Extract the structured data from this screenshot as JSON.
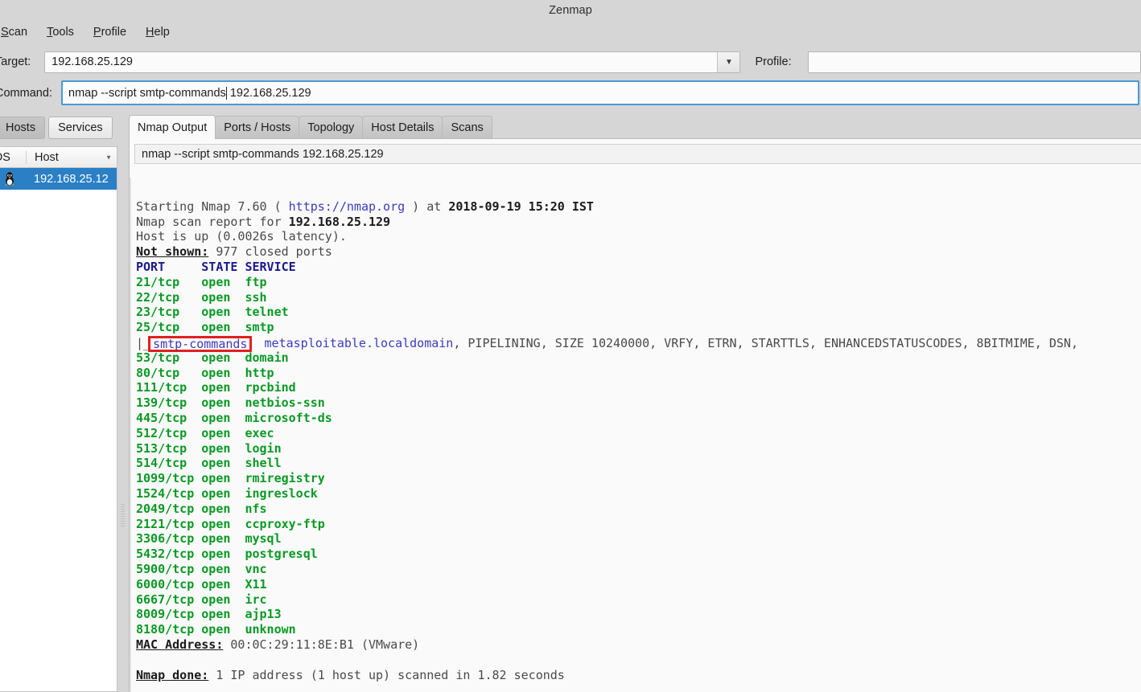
{
  "window": {
    "title": "Zenmap"
  },
  "menu": {
    "items": [
      {
        "label": "Scan",
        "mnemonic": "S"
      },
      {
        "label": "Tools",
        "mnemonic": "T"
      },
      {
        "label": "Profile",
        "mnemonic": "P"
      },
      {
        "label": "Help",
        "mnemonic": "H"
      }
    ]
  },
  "toolbar": {
    "target_label": "Target:",
    "target_value": "192.168.25.129",
    "target_placeholder": "",
    "dropdown_icon": "chevron-down-icon",
    "profile_label": "Profile:",
    "profile_value": "",
    "profile_placeholder": "",
    "command_label": "Command:",
    "command_value_before_caret": "nmap --script smtp-commands",
    "command_value_after_caret": " 192.168.25.129",
    "command_value": "nmap --script smtp-commands 192.168.25.129"
  },
  "sidebar": {
    "toggles": [
      {
        "label": "Hosts",
        "active": true
      },
      {
        "label": "Services",
        "active": false
      }
    ],
    "columns": [
      "OS",
      "Host"
    ],
    "sort_icon": "sort-descending-icon",
    "rows": [
      {
        "os_icon": "linux-penguin-icon",
        "host": "192.168.25.12"
      }
    ]
  },
  "tabs": [
    {
      "label": "Nmap Output",
      "active": true
    },
    {
      "label": "Ports / Hosts",
      "active": false
    },
    {
      "label": "Topology",
      "active": false
    },
    {
      "label": "Host Details",
      "active": false
    },
    {
      "label": "Scans",
      "active": false
    }
  ],
  "output": {
    "command_bar": "nmap --script smtp-commands 192.168.25.129",
    "lines": [
      {
        "id": "blank1",
        "text": ""
      },
      {
        "id": "starting",
        "segs": [
          {
            "t": "Starting Nmap 7.60 ( ",
            "c": "c-plain"
          },
          {
            "t": "https://nmap.org",
            "c": "c-link"
          },
          {
            "t": " ) at ",
            "c": "c-plain"
          },
          {
            "t": "2018-09-19 15:20 IST",
            "c": "c-bold"
          }
        ]
      },
      {
        "id": "scanreport",
        "segs": [
          {
            "t": "Nmap scan report for ",
            "c": "c-plain"
          },
          {
            "t": "192.168.25.129",
            "c": "c-bold"
          }
        ]
      },
      {
        "id": "hostup",
        "segs": [
          {
            "t": "Host is up (0.0026s latency).",
            "c": "c-plain"
          }
        ]
      },
      {
        "id": "notshown",
        "segs": [
          {
            "t": "Not shown:",
            "c": "c-uhdr"
          },
          {
            "t": " 977 closed ports",
            "c": "c-plain"
          }
        ]
      },
      {
        "id": "portheader",
        "segs": [
          {
            "t": "PORT     STATE SERVICE",
            "c": "c-hdr"
          }
        ]
      },
      {
        "id": "p21",
        "segs": [
          {
            "t": "21/tcp   open  ftp",
            "c": "c-port"
          }
        ]
      },
      {
        "id": "p22",
        "segs": [
          {
            "t": "22/tcp   open  ssh",
            "c": "c-port"
          }
        ]
      },
      {
        "id": "p23",
        "segs": [
          {
            "t": "23/tcp   open  telnet",
            "c": "c-port"
          }
        ]
      },
      {
        "id": "p25",
        "segs": [
          {
            "t": "25/tcp   open  smtp",
            "c": "c-port"
          }
        ]
      },
      {
        "id": "smtpscript",
        "highlight": "smtp-commands",
        "segs": [
          {
            "t": "|_",
            "c": "c-plain"
          },
          {
            "t": "smtp-commands",
            "c": "c-script",
            "box": true
          },
          {
            "t": "  metasploitable.localdomain",
            "c": "c-script"
          },
          {
            "t": ", PIPELINING, SIZE 10240000, VRFY, ETRN, STARTTLS, ENHANCEDSTATUSCODES, 8BITMIME, DSN, ",
            "c": "c-plain"
          }
        ]
      },
      {
        "id": "p53",
        "segs": [
          {
            "t": "53/tcp   open  domain",
            "c": "c-port"
          }
        ]
      },
      {
        "id": "p80",
        "segs": [
          {
            "t": "80/tcp   open  http",
            "c": "c-port"
          }
        ]
      },
      {
        "id": "p111",
        "segs": [
          {
            "t": "111/tcp  open  rpcbind",
            "c": "c-port"
          }
        ]
      },
      {
        "id": "p139",
        "segs": [
          {
            "t": "139/tcp  open  netbios-ssn",
            "c": "c-port"
          }
        ]
      },
      {
        "id": "p445",
        "segs": [
          {
            "t": "445/tcp  open  microsoft-ds",
            "c": "c-port"
          }
        ]
      },
      {
        "id": "p512",
        "segs": [
          {
            "t": "512/tcp  open  exec",
            "c": "c-port"
          }
        ]
      },
      {
        "id": "p513",
        "segs": [
          {
            "t": "513/tcp  open  login",
            "c": "c-port"
          }
        ]
      },
      {
        "id": "p514",
        "segs": [
          {
            "t": "514/tcp  open  shell",
            "c": "c-port"
          }
        ]
      },
      {
        "id": "p1099",
        "segs": [
          {
            "t": "1099/tcp open  rmiregistry",
            "c": "c-port"
          }
        ]
      },
      {
        "id": "p1524",
        "segs": [
          {
            "t": "1524/tcp open  ingreslock",
            "c": "c-port"
          }
        ]
      },
      {
        "id": "p2049",
        "segs": [
          {
            "t": "2049/tcp open  nfs",
            "c": "c-port"
          }
        ]
      },
      {
        "id": "p2121",
        "segs": [
          {
            "t": "2121/tcp open  ccproxy-ftp",
            "c": "c-port"
          }
        ]
      },
      {
        "id": "p3306",
        "segs": [
          {
            "t": "3306/tcp open  mysql",
            "c": "c-port"
          }
        ]
      },
      {
        "id": "p5432",
        "segs": [
          {
            "t": "5432/tcp open  postgresql",
            "c": "c-port"
          }
        ]
      },
      {
        "id": "p5900",
        "segs": [
          {
            "t": "5900/tcp open  vnc",
            "c": "c-port"
          }
        ]
      },
      {
        "id": "p6000",
        "segs": [
          {
            "t": "6000/tcp open  X11",
            "c": "c-port"
          }
        ]
      },
      {
        "id": "p6667",
        "segs": [
          {
            "t": "6667/tcp open  irc",
            "c": "c-port"
          }
        ]
      },
      {
        "id": "p8009",
        "segs": [
          {
            "t": "8009/tcp open  ajp13",
            "c": "c-port"
          }
        ]
      },
      {
        "id": "p8180",
        "segs": [
          {
            "t": "8180/tcp open  unknown",
            "c": "c-port"
          }
        ]
      },
      {
        "id": "mac",
        "segs": [
          {
            "t": "MAC Address:",
            "c": "c-uhdr"
          },
          {
            "t": " 00:0C:29:11:8E:B1 (VMware)",
            "c": "c-plain"
          }
        ]
      },
      {
        "id": "blank2",
        "text": ""
      },
      {
        "id": "done",
        "segs": [
          {
            "t": "Nmap done:",
            "c": "c-uhdr"
          },
          {
            "t": " 1 IP address (1 host up) scanned in 1.82 seconds",
            "c": "c-plain"
          }
        ]
      }
    ]
  },
  "colors": {
    "chrome": "#d6d6d6",
    "selection_blue": "#2b7fc4",
    "focus_blue": "#4a9ad4",
    "port_green": "#0a9a24",
    "header_navy": "#1a1a8c",
    "link_blue": "#3b3bbf",
    "annotation_red": "#e02020",
    "panel_white": "#fafafa"
  }
}
